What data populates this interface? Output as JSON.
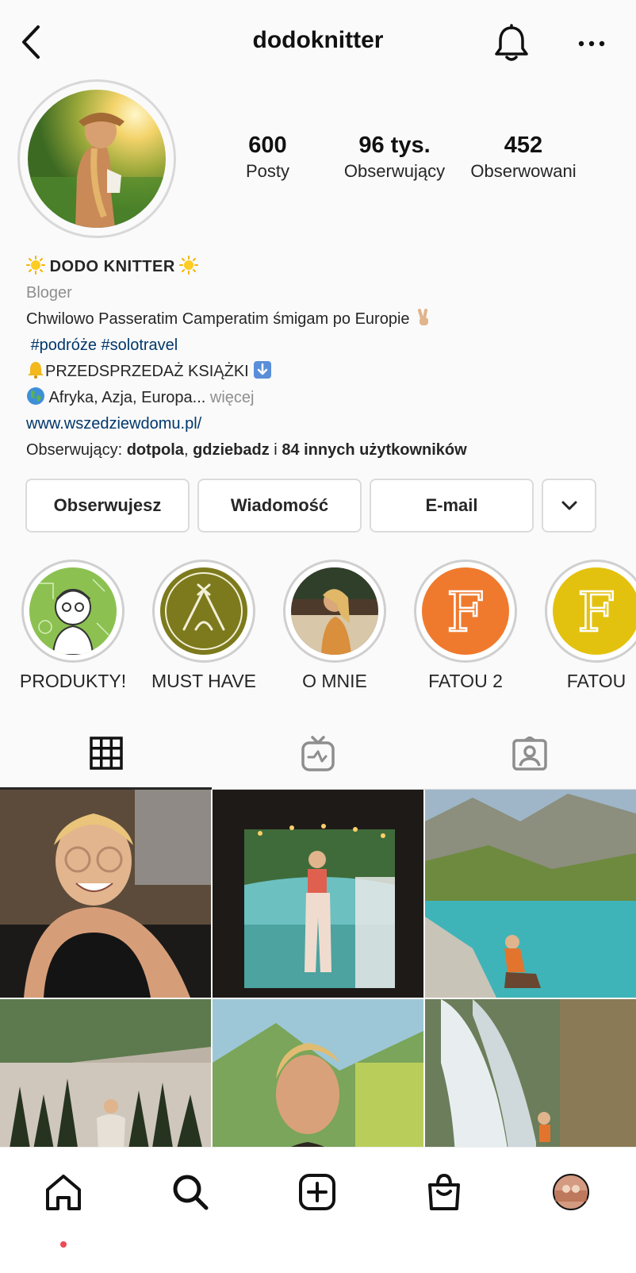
{
  "header": {
    "username": "dodoknitter"
  },
  "profile": {
    "stats": [
      {
        "value": "600",
        "label": "Posty"
      },
      {
        "value": "96 tys.",
        "label": "Obserwujący"
      },
      {
        "value": "452",
        "label": "Obserwowani"
      }
    ]
  },
  "bio": {
    "name": "DODO KNITTER",
    "category": "Bloger",
    "line1": "Chwilowo Passeratim Camperatim śmigam po Europie",
    "hashtags": "#podróże #solotravel",
    "line_preorder": "PRZEDSPRZEDAŻ KSIĄŻKI",
    "line_places": "Afryka, Azja, Europa...",
    "more": "więcej",
    "link": "www.wszedziewdomu.pl/",
    "followed_by_prefix": "Obserwujący:",
    "followed_by_user1": "dotpola",
    "followed_by_sep": ",",
    "followed_by_user2": "gdziebadz",
    "followed_by_and": "i",
    "followed_by_rest": "84 innych użytkowników"
  },
  "actions": {
    "following_label": "Obserwujesz",
    "message_label": "Wiadomość",
    "email_label": "E-mail",
    "dropdown_icon": "chevron-down-icon"
  },
  "highlights": [
    {
      "label": "PRODUKTY!",
      "color": "#8cc152"
    },
    {
      "label": "MUST HAVE",
      "color": "#7d7a1e"
    },
    {
      "label": "O MNIE",
      "color": "#b07a4a"
    },
    {
      "label": "FATOU 2",
      "color": "#ef7a2e"
    },
    {
      "label": "FATOU",
      "color": "#e3c20f"
    }
  ],
  "tabs": [
    {
      "icon": "grid-icon",
      "active": true
    },
    {
      "icon": "igtv-icon",
      "active": false
    },
    {
      "icon": "tagged-icon",
      "active": false
    }
  ],
  "bottom_nav": [
    {
      "icon": "home-icon"
    },
    {
      "icon": "search-icon"
    },
    {
      "icon": "new-post-icon"
    },
    {
      "icon": "shop-icon"
    },
    {
      "icon": "profile-avatar-icon"
    }
  ],
  "colors": {
    "link": "#00376b",
    "muted": "#8e8e8e",
    "notification_dot": "#ed4956"
  }
}
